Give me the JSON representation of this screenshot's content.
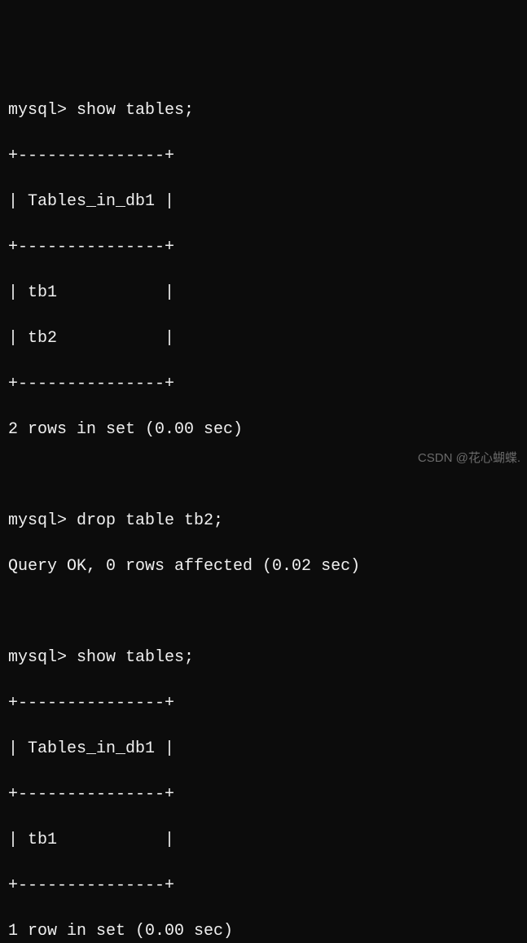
{
  "session": {
    "block1": {
      "prompt": "mysql> show tables;",
      "border_top": "+---------------+",
      "header": "| Tables_in_db1 |",
      "border_mid": "+---------------+",
      "row1": "| tb1           |",
      "row2": "| tb2           |",
      "border_bottom": "+---------------+",
      "summary": "2 rows in set (0.00 sec)"
    },
    "blank1": " ",
    "block2": {
      "prompt": "mysql> drop table tb2;",
      "result": "Query OK, 0 rows affected (0.02 sec)"
    },
    "blank2": " ",
    "block3": {
      "prompt": "mysql> show tables;",
      "border_top": "+---------------+",
      "header": "| Tables_in_db1 |",
      "border_mid": "+---------------+",
      "row1": "| tb1           |",
      "border_bottom": "+---------------+",
      "summary": "1 row in set (0.00 sec)"
    }
  },
  "watermark": "CSDN @花心蝴蝶."
}
